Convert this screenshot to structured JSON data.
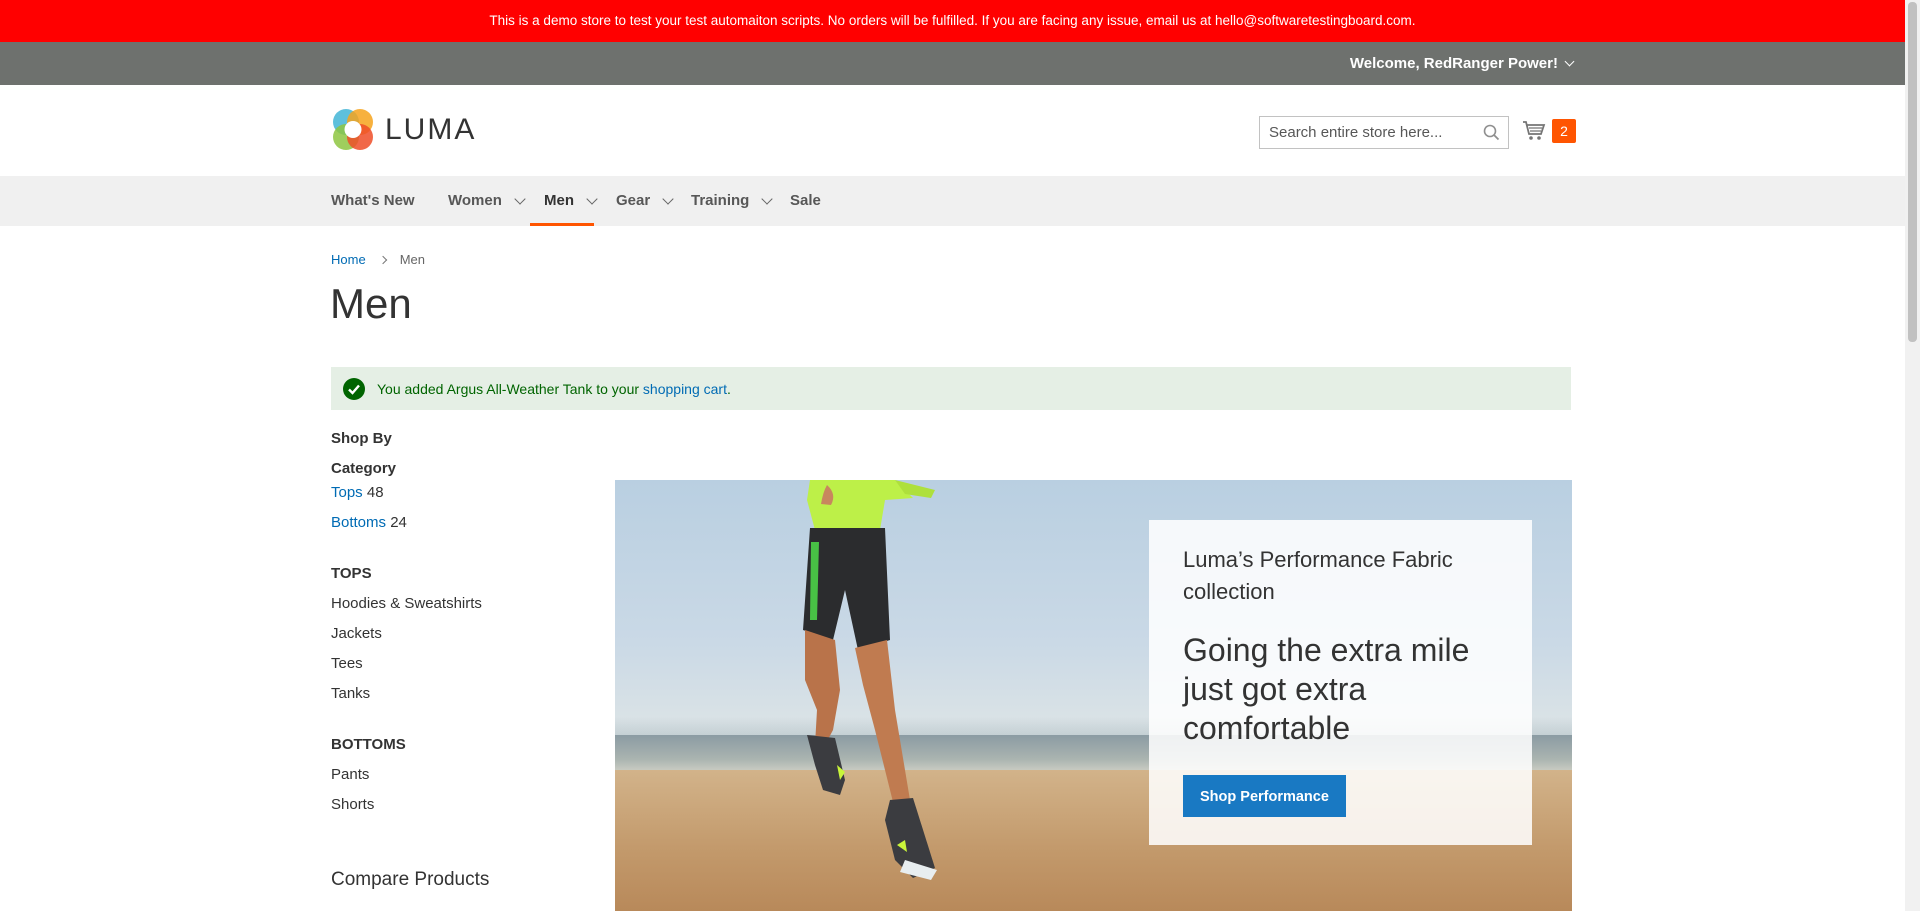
{
  "demo_notice": "This is a demo store to test your test automaiton scripts. No orders will be fulfilled. If you are facing any issue, email us at hello@softwaretestingboard.com.",
  "header": {
    "welcome": "Welcome, RedRanger Power!",
    "logo_text": "LUMA",
    "search_placeholder": "Search entire store here...",
    "cart_count": "2"
  },
  "nav": {
    "items": [
      {
        "label": "What's New"
      },
      {
        "label": "Women"
      },
      {
        "label": "Men"
      },
      {
        "label": "Gear"
      },
      {
        "label": "Training"
      },
      {
        "label": "Sale"
      }
    ],
    "active": "Men"
  },
  "breadcrumb": {
    "home": "Home",
    "current": "Men"
  },
  "page_title": "Men",
  "message": {
    "prefix": "You added Argus All-Weather Tank to your",
    "link": "shopping cart",
    "suffix": "."
  },
  "sidebar": {
    "shop_by": "Shop By",
    "category_title": "Category",
    "categories": [
      {
        "label": "Tops",
        "count": "48"
      },
      {
        "label": "Bottoms",
        "count": "24"
      }
    ],
    "tops_heading": "TOPS",
    "tops_items": [
      "Hoodies & Sweatshirts",
      "Jackets",
      "Tees",
      "Tanks"
    ],
    "bottoms_heading": "BOTTOMS",
    "bottoms_items": [
      "Pants",
      "Shorts"
    ],
    "compare": "Compare Products"
  },
  "hero": {
    "subtitle": "Luma’s Performance Fabric collection",
    "title": "Going the extra mile just got extra comfortable",
    "button": "Shop Performance"
  },
  "colors": {
    "demo_bar": "#ff0000",
    "panel": "#6e716e",
    "accent": "#ff5501",
    "link": "#006bb4",
    "button": "#1979c3",
    "success_bg": "#e5efe5"
  }
}
